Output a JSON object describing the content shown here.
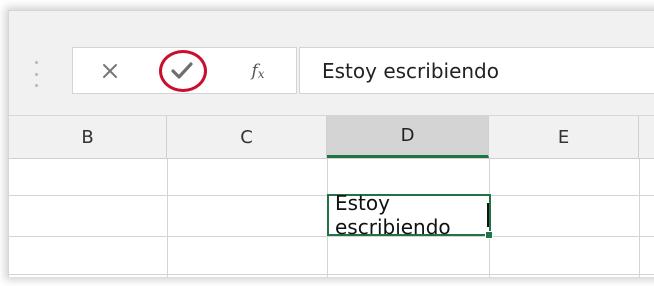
{
  "formula_bar": {
    "cancel_icon": "close-icon",
    "enter_icon": "checkmark-icon",
    "function_label": "f",
    "function_sub": "x",
    "content": "Estoy escribiendo"
  },
  "columns": [
    "B",
    "C",
    "D",
    "E"
  ],
  "active_column": "D",
  "active_cell": {
    "column": "D",
    "value": "Estoy escribiendo"
  },
  "colors": {
    "accent": "#217346",
    "highlight_ring": "#c8102e",
    "header_bg": "#f1f1f1",
    "active_header_bg": "#d4d4d4"
  }
}
